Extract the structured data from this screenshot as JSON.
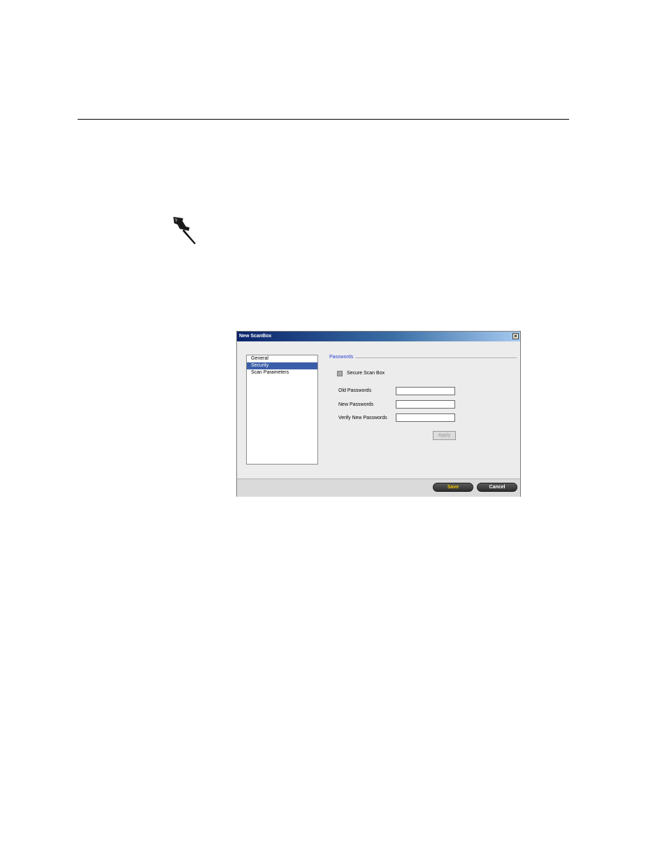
{
  "dialog": {
    "title": "New ScanBox",
    "close_glyph": "×",
    "nav_items": [
      {
        "label": "General",
        "selected": false
      },
      {
        "label": "Security",
        "selected": true
      },
      {
        "label": "Scan Parameters",
        "selected": false
      }
    ],
    "group_title": "Passwords",
    "secure_checkbox_label": "Secure Scan Box",
    "fields": {
      "old_label": "Old Passwords",
      "new_label": "New Passwords",
      "verify_label": "Verify New Passwords"
    },
    "apply_label": "Apply",
    "save_label": "Save",
    "cancel_label": "Cancel"
  },
  "icons": {
    "note": "pushpin-icon",
    "close": "close-icon"
  },
  "colors": {
    "selection": "#3a5ea8",
    "group_title": "#2a3fd0",
    "save_text": "#f4c300"
  }
}
